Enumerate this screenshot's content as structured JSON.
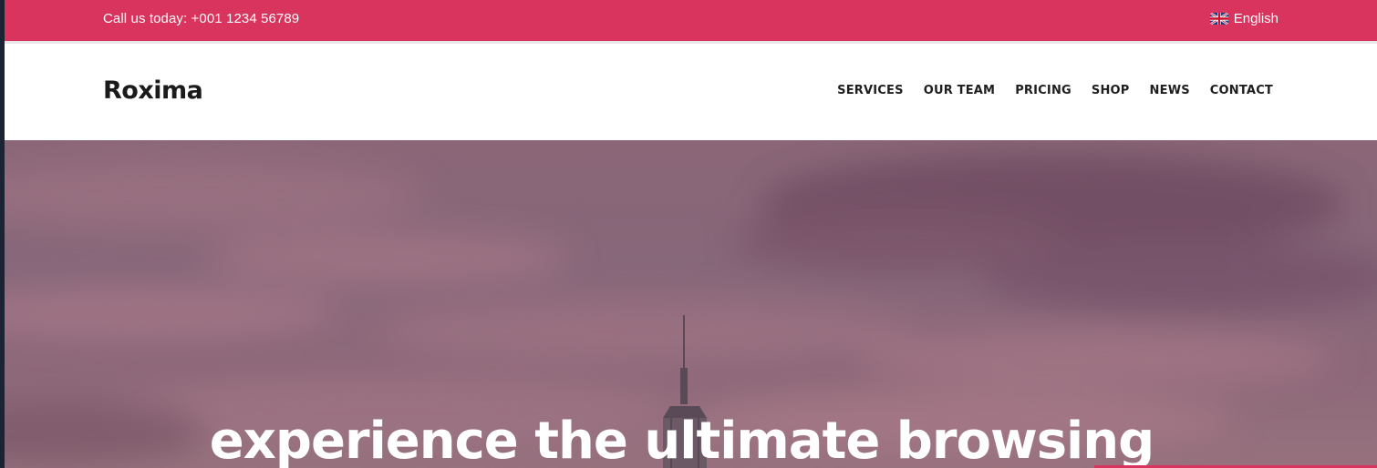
{
  "topbar": {
    "phone": "Call us today: +001 1234 56789",
    "language": "English",
    "language_icon": "uk-flag-icon",
    "color": "#d9345e"
  },
  "header": {
    "logo": "Roxima",
    "nav": [
      {
        "label": "SERVICES"
      },
      {
        "label": "OUR TEAM"
      },
      {
        "label": "PRICING"
      },
      {
        "label": "SHOP"
      },
      {
        "label": "NEWS"
      },
      {
        "label": "CONTACT"
      }
    ]
  },
  "hero": {
    "title": "experience the ultimate browsing",
    "overlay_color": "#8a6677"
  }
}
